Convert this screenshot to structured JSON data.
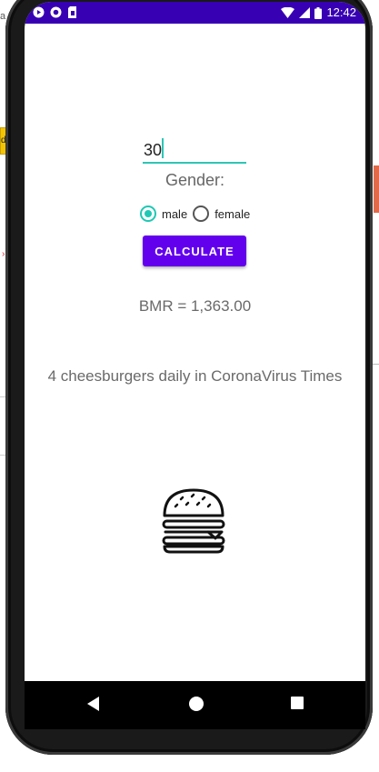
{
  "background": {
    "fragment_top_left": "a",
    "fragment_yellow": "de"
  },
  "status_bar": {
    "time": "12:42",
    "color": "#3700b3"
  },
  "form": {
    "age_value": "30",
    "gender_label": "Gender:",
    "gender_options": [
      {
        "label": "male",
        "selected": true
      },
      {
        "label": "female",
        "selected": false
      }
    ],
    "calculate_label": "CALCULATE",
    "button_color": "#6200ee",
    "accent_color": "#1ec8b4"
  },
  "result": {
    "bmr_text": "BMR = 1,363.00",
    "burger_text": "4 cheesburgers daily in CoronaVirus Times",
    "icon": "hamburger-icon"
  },
  "nav_bar": {
    "icons": [
      "back-icon",
      "home-icon",
      "recents-icon"
    ]
  }
}
